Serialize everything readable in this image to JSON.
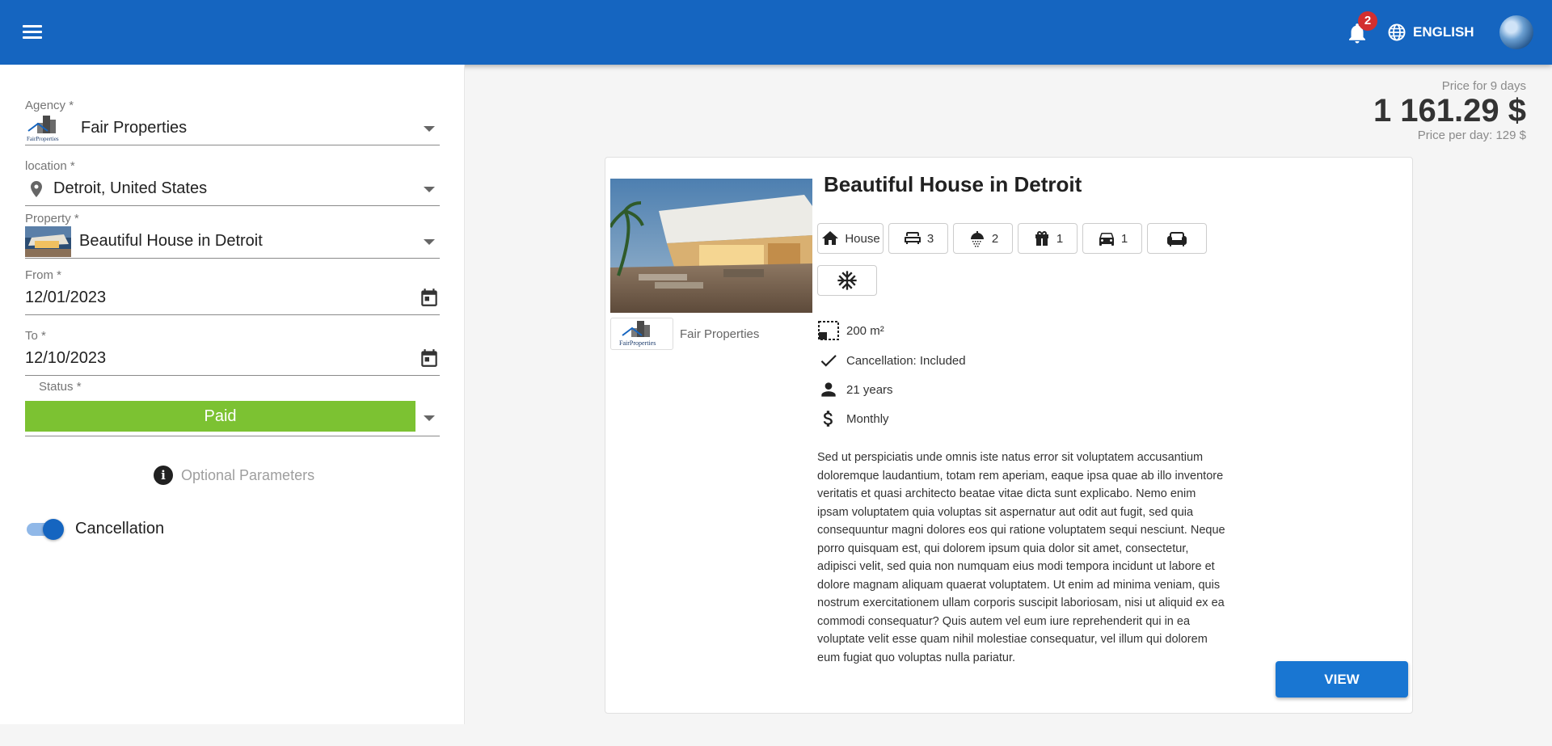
{
  "topbar": {
    "notification_count": "2",
    "language": "ENGLISH"
  },
  "form": {
    "agency": {
      "label": "Agency *",
      "value": "Fair Properties"
    },
    "location": {
      "label": "location *",
      "value": "Detroit, United States"
    },
    "property": {
      "label": "Property *",
      "value": "Beautiful House in Detroit"
    },
    "from": {
      "label": "From *",
      "value": "12/01/2023"
    },
    "to": {
      "label": "To *",
      "value": "12/10/2023"
    },
    "status": {
      "label": "Status *",
      "value": "Paid",
      "color": "#7cc232"
    },
    "optional_parameters": "Optional Parameters",
    "cancellation": {
      "label": "Cancellation",
      "enabled": true
    }
  },
  "price": {
    "days_label": "Price for 9 days",
    "total": "1 161.29 $",
    "per_day": "Price per day: 129 $"
  },
  "card": {
    "title": "Beautiful House in Detroit",
    "agency_name": "Fair Properties",
    "agency_logo_text": "FairProperties",
    "chips": [
      {
        "icon": "house-icon",
        "label": "House"
      },
      {
        "icon": "bed-icon",
        "label": "3"
      },
      {
        "icon": "shower-icon",
        "label": "2"
      },
      {
        "icon": "gift-icon",
        "label": "1"
      },
      {
        "icon": "car-icon",
        "label": "1"
      },
      {
        "icon": "sofa-icon",
        "label": ""
      },
      {
        "icon": "snowflake-icon",
        "label": ""
      }
    ],
    "props": {
      "size": "200 m²",
      "cancellation": "Cancellation: Included",
      "age": "21 years",
      "payment": "Monthly"
    },
    "description": "Sed ut perspiciatis unde omnis iste natus error sit voluptatem accusantium doloremque laudantium, totam rem aperiam, eaque ipsa quae ab illo inventore veritatis et quasi architecto beatae vitae dicta sunt explicabo. Nemo enim ipsam voluptatem quia voluptas sit aspernatur aut odit aut fugit, sed quia consequuntur magni dolores eos qui ratione voluptatem sequi nesciunt. Neque porro quisquam est, qui dolorem ipsum quia dolor sit amet, consectetur, adipisci velit, sed quia non numquam eius modi tempora incidunt ut labore et dolore magnam aliquam quaerat voluptatem. Ut enim ad minima veniam, quis nostrum exercitationem ullam corporis suscipit laboriosam, nisi ut aliquid ex ea commodi consequatur? Quis autem vel eum iure reprehenderit qui in ea voluptate velit esse quam nihil molestiae consequatur, vel illum qui dolorem eum fugiat quo voluptas nulla pariatur.",
    "view_label": "VIEW"
  },
  "colors": {
    "primary": "#1565c0",
    "button": "#1976d2",
    "status_paid": "#7cc232"
  }
}
